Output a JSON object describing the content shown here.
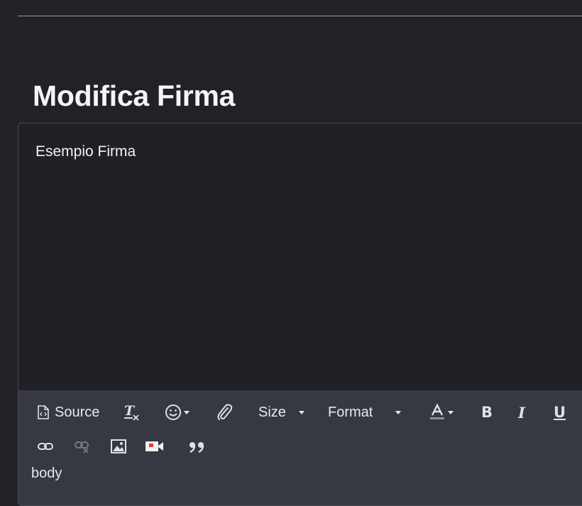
{
  "page": {
    "title": "Modifica Firma"
  },
  "editor": {
    "content_text": "Esempio Firma",
    "path": "body"
  },
  "toolbar": {
    "source_label": "Source",
    "size_label": "Size",
    "format_label": "Format",
    "icons": {
      "source": "source-icon",
      "remove_format": "remove-format-icon",
      "emoji": "smiley-icon",
      "attach": "paperclip-icon",
      "text_color": "text-color-icon",
      "bold": "bold-icon",
      "italic": "italic-icon",
      "underline": "underline-icon",
      "link": "link-icon",
      "unlink": "unlink-icon",
      "image": "image-icon",
      "video": "video-icon",
      "blockquote": "blockquote-icon"
    },
    "glyphs": {
      "bold": "B",
      "italic": "I",
      "underline": "U"
    }
  },
  "colors": {
    "background": "#222226",
    "editor_background": "#202026",
    "toolbar_background": "#363842",
    "video_icon_accent": "#e53935"
  }
}
